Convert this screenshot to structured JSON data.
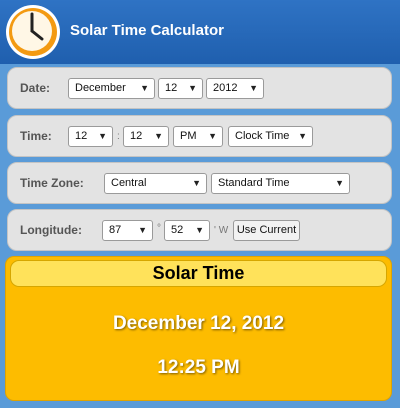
{
  "app": {
    "title": "Solar Time Calculator"
  },
  "date": {
    "label": "Date:",
    "month": "December",
    "day": "12",
    "year": "2012"
  },
  "time": {
    "label": "Time:",
    "hour": "12",
    "minute": "12",
    "separator": ":",
    "ampm": "PM",
    "mode": "Clock Time"
  },
  "timezone": {
    "label": "Time Zone:",
    "zone": "Central",
    "type": "Standard Time"
  },
  "longitude": {
    "label": "Longitude:",
    "degrees": "87",
    "degree_symbol": "°",
    "minutes": "52",
    "minute_symbol": "' W",
    "use_current_label": "Use Current"
  },
  "result": {
    "title": "Solar Time",
    "date": "December 12, 2012",
    "time": "12:25 PM"
  },
  "colors": {
    "header": "#1f5fae",
    "background": "#5a9bd8",
    "result": "#fdbc00",
    "result_header": "#ffe25a"
  },
  "icons": {
    "app": "clock-icon",
    "dropdown": "chevron-down-icon"
  }
}
